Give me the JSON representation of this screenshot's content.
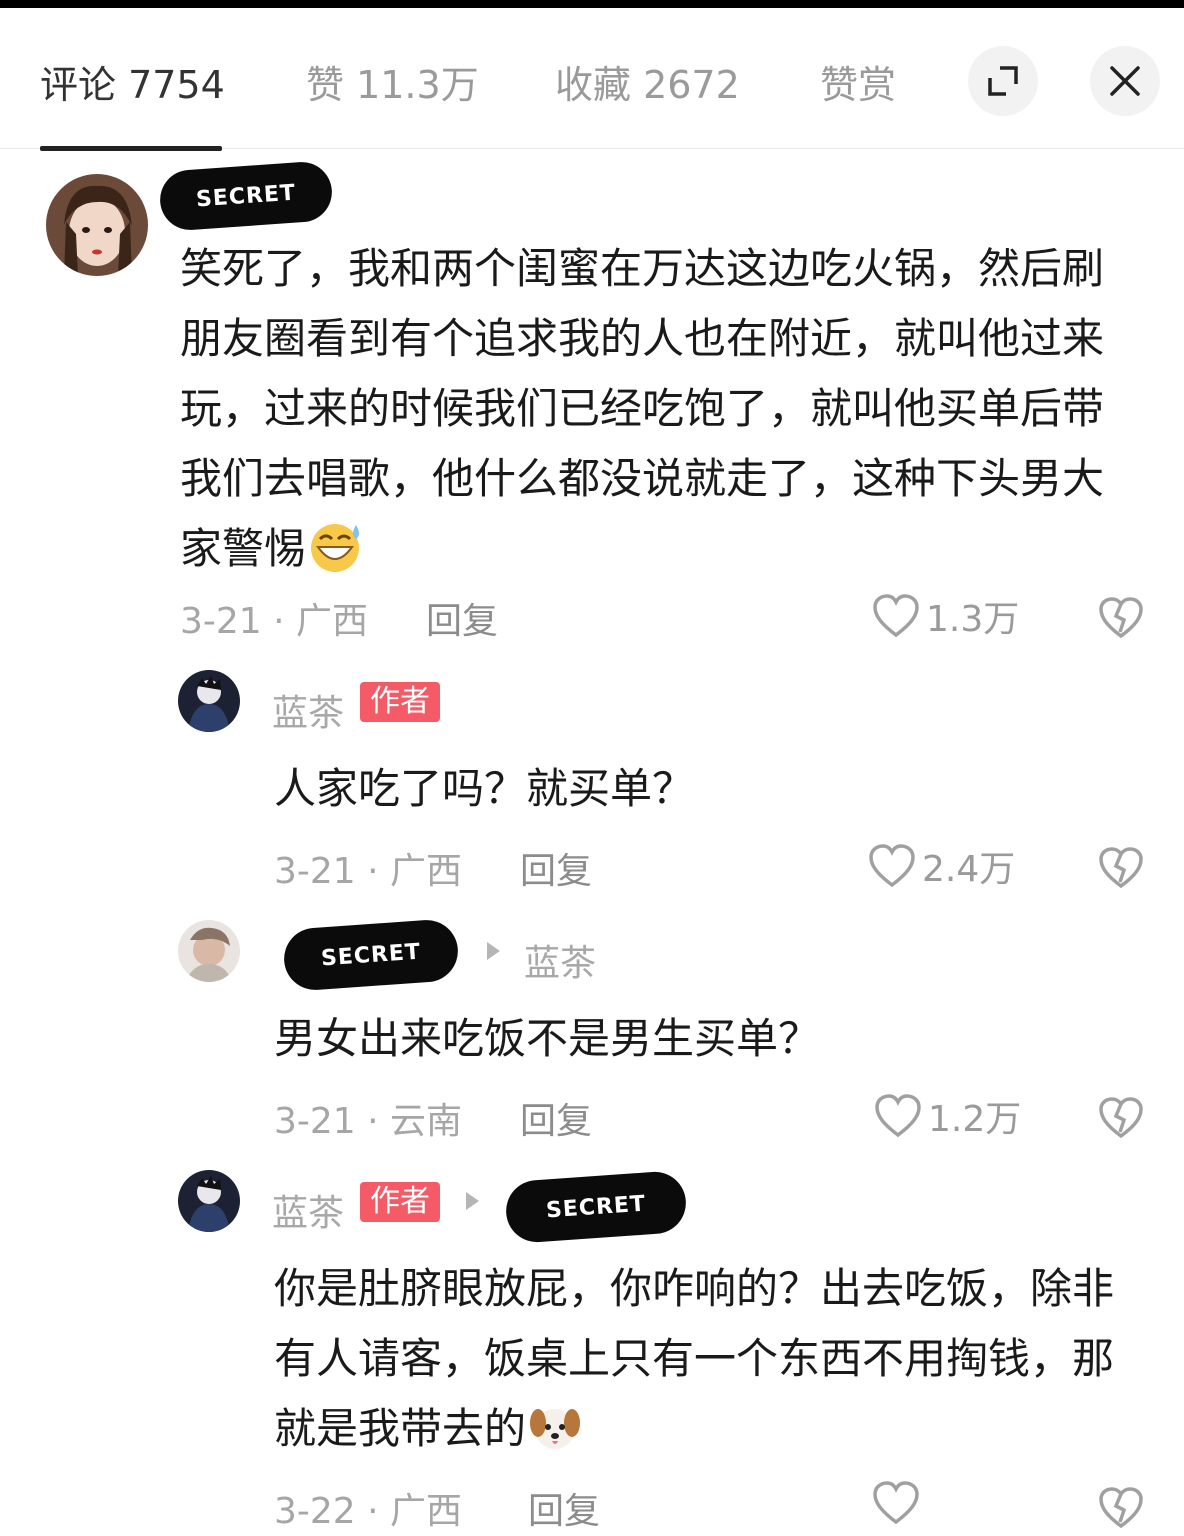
{
  "tabs": [
    {
      "label": "评论 7754"
    },
    {
      "label": "赞 11.3万"
    },
    {
      "label": "收藏 2672"
    },
    {
      "label": "赞赏"
    }
  ],
  "icons": {
    "expand": "expand-icon",
    "close": "close-icon",
    "like": "heart-icon",
    "dislike": "broken-heart-icon"
  },
  "redaction_label": "SECRET",
  "comments": [
    {
      "text": "笑死了，我和两个闺蜜在万达这边吃火锅，然后刷朋友圈看到有个追求我的人也在附近，就叫他过来玩，过来的时候我们已经吃饱了，就叫他买单后带我们去唱歌，他什么都没说就走了，这种下头男大家警惕",
      "emoji": "grinning-sweat-emoji",
      "date": "3-21",
      "region": "广西",
      "reply": "回复",
      "likes": "1.3万"
    },
    {
      "name": "蓝茶",
      "badge": "作者",
      "text": "人家吃了吗？就买单？",
      "date": "3-21",
      "region": "广西",
      "reply": "回复",
      "likes": "2.4万"
    },
    {
      "reply_to": "蓝茶",
      "text": "男女出来吃饭不是男生买单？",
      "date": "3-21",
      "region": "云南",
      "reply": "回复",
      "likes": "1.2万"
    },
    {
      "name": "蓝茶",
      "badge": "作者",
      "text": "你是肚脐眼放屁，你咋响的？出去吃饭，除非有人请客，饭桌上只有一个东西不用掏钱，那就是我带去的",
      "emoji": "dog-emoji",
      "date": "3-22",
      "region": "广西",
      "reply": "回复"
    }
  ]
}
